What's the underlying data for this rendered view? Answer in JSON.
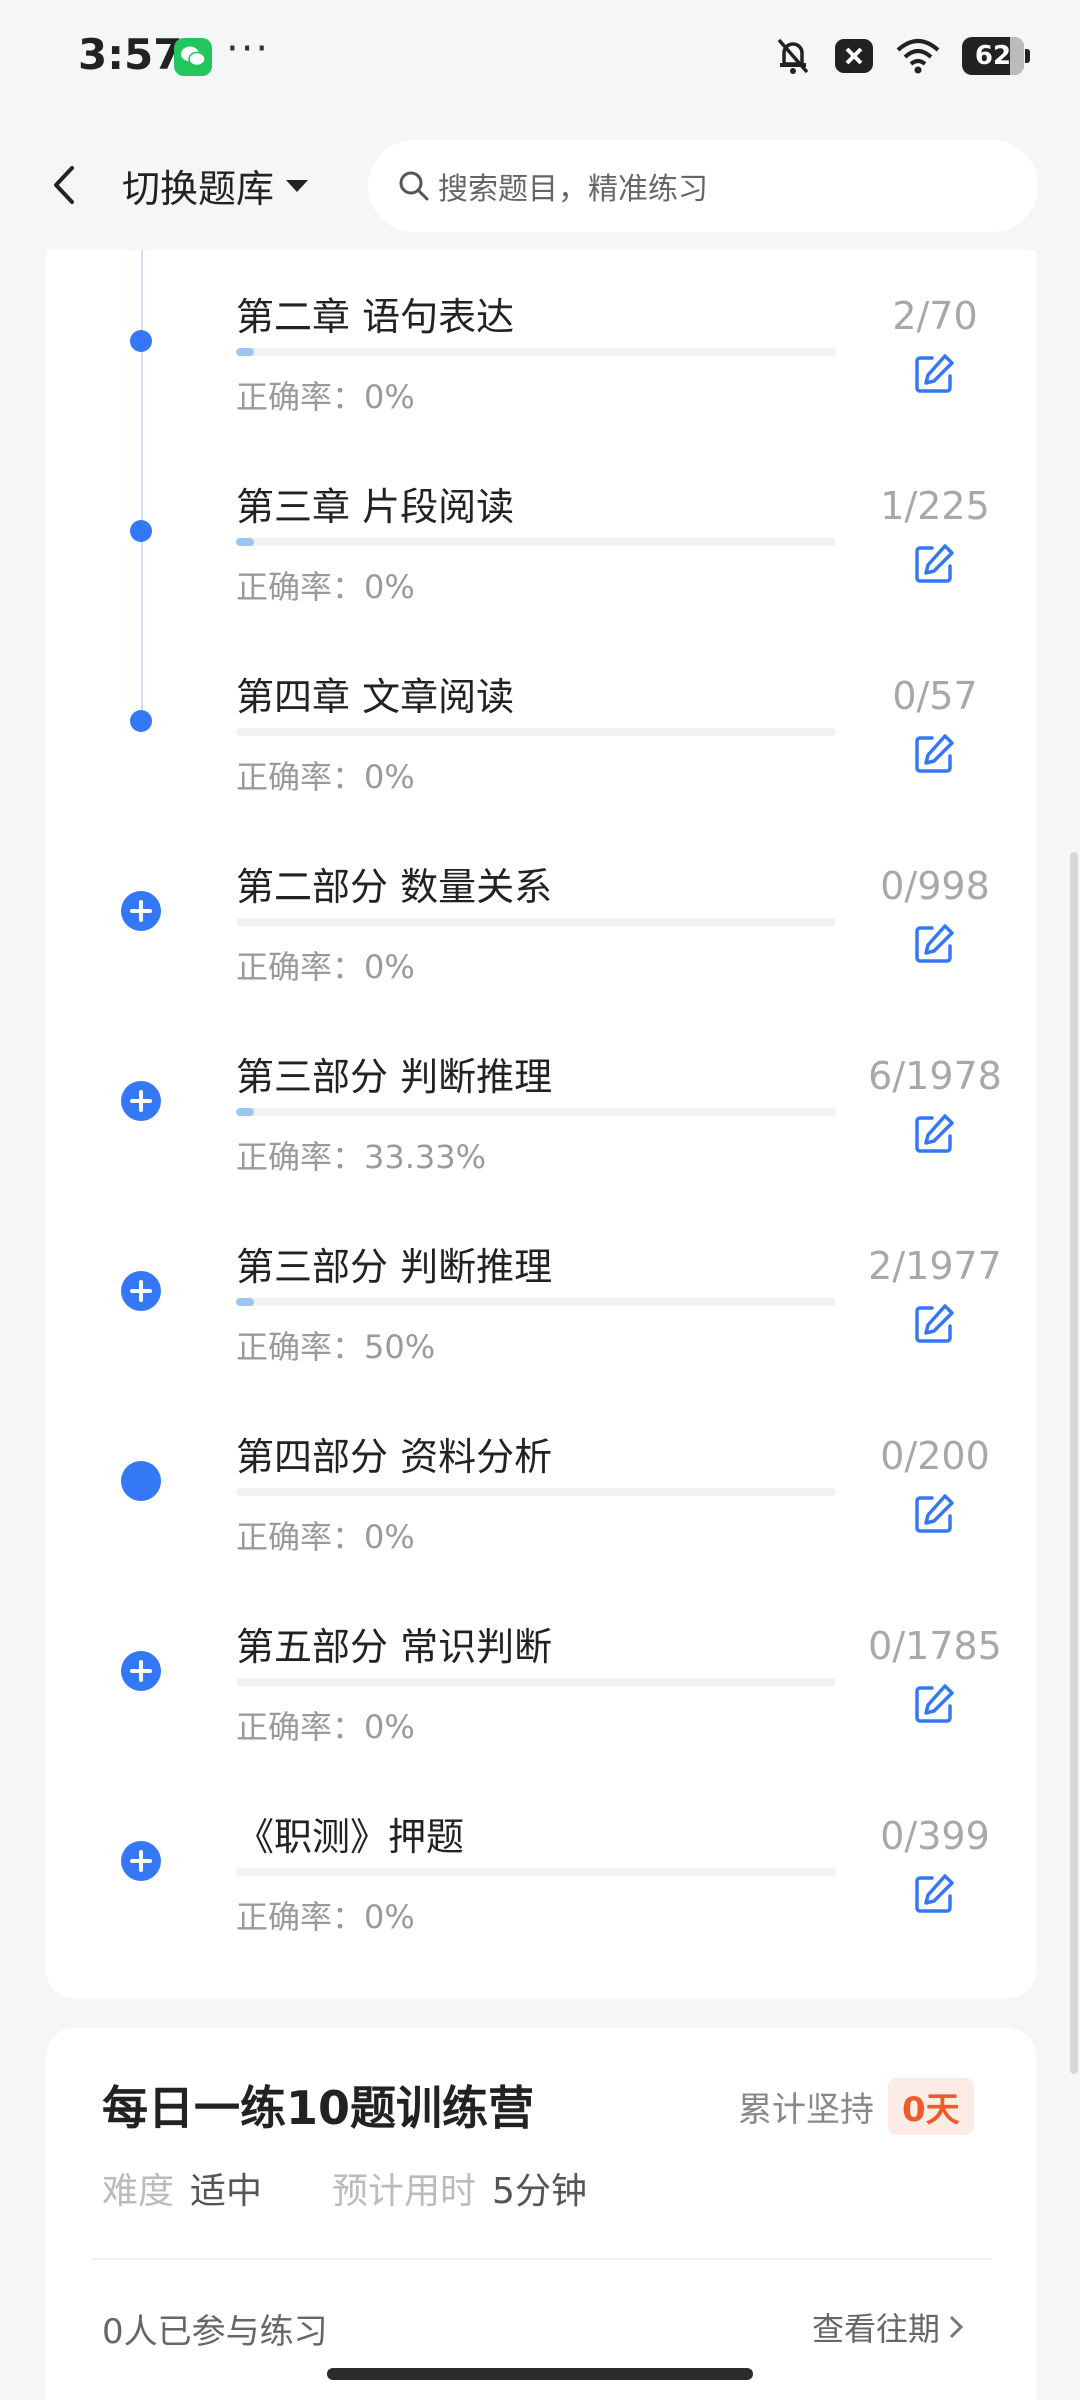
{
  "status_bar": {
    "time": "3:57",
    "more": "···",
    "battery": "62",
    "icons": [
      "wechat-icon",
      "mute-bell-icon",
      "close-box-icon",
      "wifi-icon",
      "battery-icon"
    ]
  },
  "header": {
    "back_icon": "chevron-left-icon",
    "switch_label": "切换题库",
    "search_placeholder": "搜索题目，精准练习"
  },
  "chapters": [
    {
      "title": "第二章 语句表达",
      "count": "2/70",
      "accuracy": "正确率：0%",
      "progress": 0.029,
      "marker": "dot"
    },
    {
      "title": "第三章 片段阅读",
      "count": "1/225",
      "accuracy": "正确率：0%",
      "progress": 0.004,
      "marker": "dot"
    },
    {
      "title": "第四章 文章阅读",
      "count": "0/57",
      "accuracy": "正确率：0%",
      "progress": 0,
      "marker": "dot"
    },
    {
      "title": "第二部分 数量关系",
      "count": "0/998",
      "accuracy": "正确率：0%",
      "progress": 0,
      "marker": "plus"
    },
    {
      "title": "第三部分 判断推理",
      "count": "6/1978",
      "accuracy": "正确率：33.33%",
      "progress": 0.003,
      "marker": "plus"
    },
    {
      "title": "第三部分 判断推理",
      "count": "2/1977",
      "accuracy": "正确率：50%",
      "progress": 0.001,
      "marker": "plus"
    },
    {
      "title": "第四部分 资料分析",
      "count": "0/200",
      "accuracy": "正确率：0%",
      "progress": 0,
      "marker": "dot-big"
    },
    {
      "title": "第五部分 常识判断",
      "count": "0/1785",
      "accuracy": "正确率：0%",
      "progress": 0,
      "marker": "plus"
    },
    {
      "title": "《职测》押题",
      "count": "0/399",
      "accuracy": "正确率：0%",
      "progress": 0,
      "marker": "plus"
    }
  ],
  "camp": {
    "title": "每日一练10题训练营",
    "persist_label": "累计坚持",
    "persist_days": "0天",
    "difficulty_label": "难度",
    "difficulty_value": "适中",
    "time_label": "预计用时",
    "time_value": "5分钟",
    "joined": "0人已参与练习",
    "history": "查看往期"
  },
  "colors": {
    "accent": "#3478f6",
    "orange": "#f05a28"
  }
}
